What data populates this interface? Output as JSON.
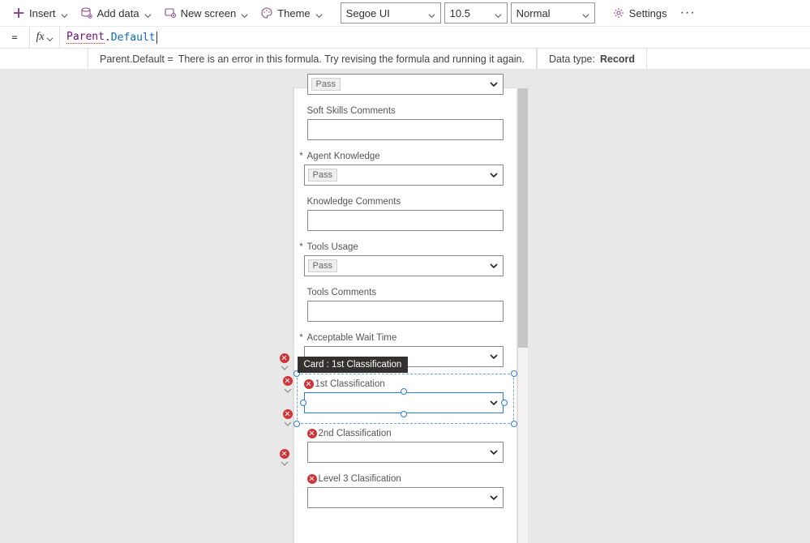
{
  "toolbar": {
    "insert": "Insert",
    "add_data": "Add data",
    "new_screen": "New screen",
    "theme": "Theme",
    "font": "Segoe UI",
    "font_size": "10.5",
    "font_weight": "Normal",
    "settings": "Settings"
  },
  "formula_bar": {
    "eq": "=",
    "fx": "fx",
    "object": "Parent",
    "property": "Default",
    "error_prefix": "Parent.Default  =",
    "error_message": "There is an error in this formula. Try revising the formula and running it again.",
    "data_type_label": "Data type:",
    "data_type_value": "Record"
  },
  "tooltip": "Card : 1st Classification",
  "form": [
    {
      "label": "",
      "value": "Pass",
      "required": false,
      "dropdown": true,
      "truncated_top": true
    },
    {
      "label": "Soft Skills Comments",
      "value": "",
      "required": false,
      "dropdown": false
    },
    {
      "label": "Agent Knowledge",
      "value": "Pass",
      "required": true,
      "dropdown": true
    },
    {
      "label": "Knowledge Comments",
      "value": "",
      "required": false,
      "dropdown": false
    },
    {
      "label": "Tools Usage",
      "value": "Pass",
      "required": true,
      "dropdown": true
    },
    {
      "label": "Tools Comments",
      "value": "",
      "required": false,
      "dropdown": false
    },
    {
      "label": "Acceptable Wait Time",
      "value": "",
      "required": true,
      "dropdown": true,
      "edge_error": true
    },
    {
      "label": "1st Classification",
      "value": "",
      "required": false,
      "dropdown": true,
      "selected": true,
      "error": true
    },
    {
      "label": "2nd Classification",
      "value": "",
      "required": false,
      "dropdown": true,
      "error": true,
      "edge_error": true
    },
    {
      "label": "Level 3 Clasification",
      "value": "",
      "required": false,
      "dropdown": true,
      "error": true
    }
  ]
}
